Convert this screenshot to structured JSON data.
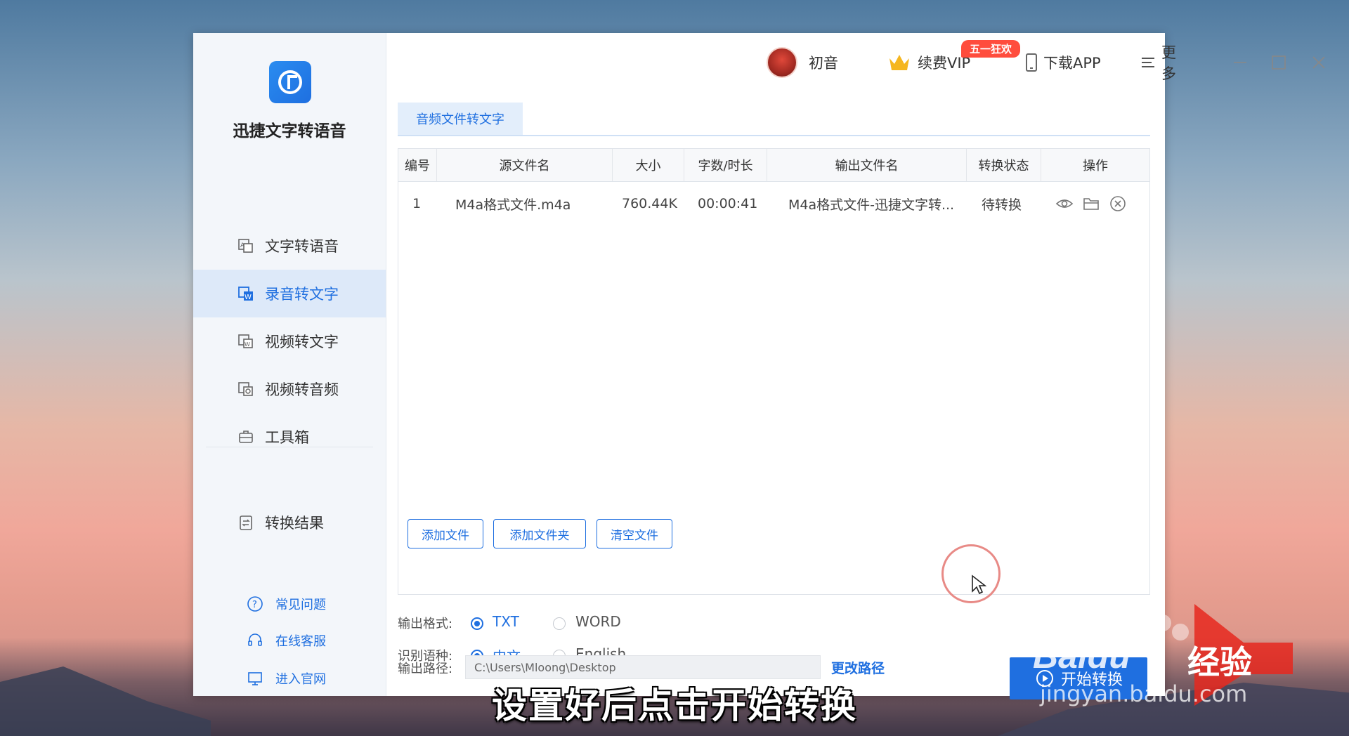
{
  "app": {
    "name": "迅捷文字转语音"
  },
  "sidebar": {
    "items": [
      {
        "label": "文字转语音",
        "icon": "text-to-speech-icon"
      },
      {
        "label": "录音转文字",
        "icon": "audio-to-text-icon"
      },
      {
        "label": "视频转文字",
        "icon": "video-to-text-icon"
      },
      {
        "label": "视频转音频",
        "icon": "video-to-audio-icon"
      },
      {
        "label": "工具箱",
        "icon": "toolbox-icon"
      },
      {
        "label": "转换结果",
        "icon": "result-icon"
      }
    ],
    "help": [
      {
        "label": "常见问题",
        "icon": "question-icon"
      },
      {
        "label": "在线客服",
        "icon": "headset-icon"
      },
      {
        "label": "进入官网",
        "icon": "monitor-icon"
      }
    ]
  },
  "topbar": {
    "user": "初音",
    "vip": "续费VIP",
    "vip_badge": "五一狂欢",
    "download": "下载APP",
    "more": "更多"
  },
  "tab": {
    "label": "音频文件转文字"
  },
  "table": {
    "headers": [
      "编号",
      "源文件名",
      "大小",
      "字数/时长",
      "输出文件名",
      "转换状态",
      "操作"
    ],
    "rows": [
      {
        "index": "1",
        "source": "M4a格式文件.m4a",
        "size": "760.44K",
        "duration": "00:00:41",
        "output": "M4a格式文件-迅捷文字转...",
        "status": "待转换"
      }
    ]
  },
  "buttons": {
    "add_file": "添加文件",
    "add_folder": "添加文件夹",
    "clear_files": "清空文件"
  },
  "output_format": {
    "label": "输出格式:",
    "options": [
      "TXT",
      "WORD"
    ],
    "selected": "TXT"
  },
  "language": {
    "label": "识别语种:",
    "options": [
      "中文",
      "English"
    ],
    "selected": "中文"
  },
  "output_path": {
    "label": "输出路径:",
    "value": "C:\\Users\\Mloong\\Desktop",
    "change": "更改路径"
  },
  "start": {
    "label": "开始转换"
  },
  "subtitle": "设置好后点击开始转换",
  "watermark": {
    "brand": "Baidu",
    "jingyan": "经验",
    "url": "jingyan.baidu.com"
  },
  "colors": {
    "accent": "#1f6fe0",
    "badge": "#ff4d3d",
    "active_bg": "#dde9f9"
  }
}
